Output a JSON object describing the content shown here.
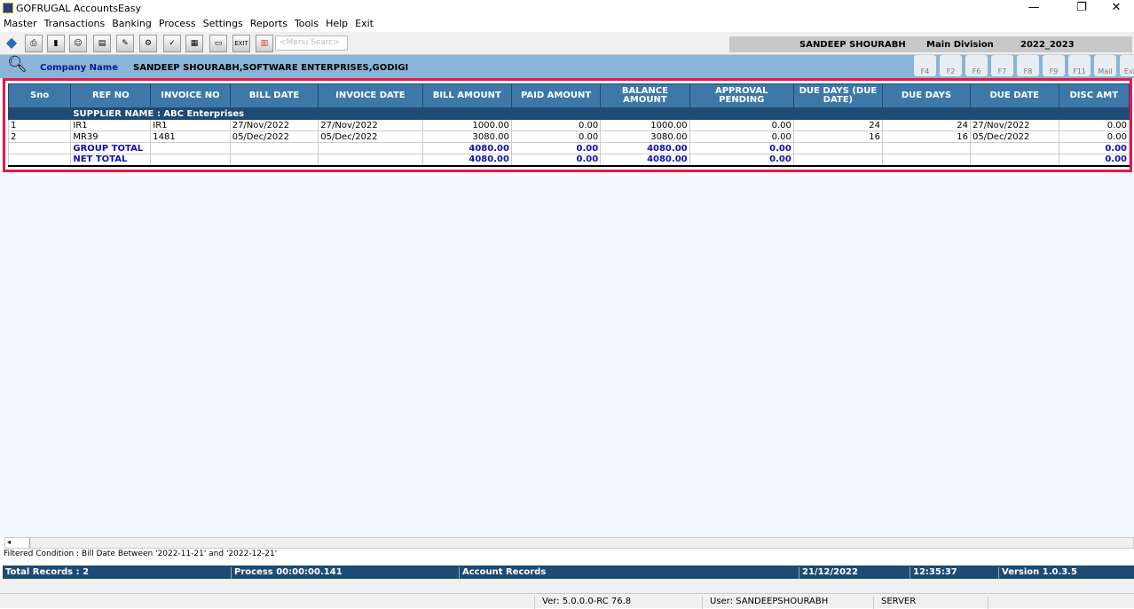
{
  "app": {
    "title": "GOFRUGAL AccountsEasy"
  },
  "menu": [
    "Master",
    "Transactions",
    "Banking",
    "Process",
    "Settings",
    "Reports",
    "Tools",
    "Help",
    "Exit"
  ],
  "toolbar": {
    "menu_search_placeholder": "<Menu Searc>",
    "exit_label": "EXIT"
  },
  "user_panel": {
    "user": "SANDEEP SHOURABH",
    "division": "Main Division",
    "year": "2022_2023"
  },
  "header": {
    "company_label": "Company Name",
    "company_value": "SANDEEP SHOURABH,SOFTWARE ENTERPRISES,GODIGI",
    "fkeys": [
      "F4",
      "F2",
      "F6",
      "F7",
      "F8",
      "F9",
      "F11",
      "Mail",
      "Exit"
    ]
  },
  "table": {
    "columns": [
      "Sno",
      "REF NO",
      "INVOICE NO",
      "BILL DATE",
      "INVOICE DATE",
      "BILL AMOUNT",
      "PAID AMOUNT",
      "BALANCE AMOUNT",
      "APPROVAL PENDING",
      "DUE DAYS (DUE DATE)",
      "DUE DAYS",
      "DUE DATE",
      "DISC AMT"
    ],
    "group_label": "SUPPLIER NAME : ABC Enterprises",
    "rows": [
      [
        "1",
        "IR1",
        "IR1",
        "27/Nov/2022",
        "27/Nov/2022",
        "1000.00",
        "0.00",
        "1000.00",
        "0.00",
        "24",
        "24",
        "27/Nov/2022",
        "0.00"
      ],
      [
        "2",
        "MR39",
        "1481",
        "05/Dec/2022",
        "05/Dec/2022",
        "3080.00",
        "0.00",
        "3080.00",
        "0.00",
        "16",
        "16",
        "05/Dec/2022",
        "0.00"
      ]
    ],
    "group_total": {
      "label": "GROUP TOTAL",
      "bill": "4080.00",
      "paid": "0.00",
      "balance": "4080.00",
      "approval": "0.00",
      "disc": "0.00"
    },
    "net_total": {
      "label": "NET TOTAL",
      "bill": "4080.00",
      "paid": "0.00",
      "balance": "4080.00",
      "approval": "0.00",
      "disc": "0.00"
    }
  },
  "filter": "Filtered Condition : Bill Date Between '2022-11-21' and '2022-12-21'",
  "status": {
    "records": "Total Records : 2",
    "process": "Process 00:00:00.141",
    "type": "Account Records",
    "date": "21/12/2022",
    "time": "12:35:37",
    "version": "Version 1.0.3.5"
  },
  "bottom": {
    "ver": "Ver: 5.0.0.0-RC 76.8",
    "user": "User: SANDEEPSHOURABH",
    "server": "SERVER"
  }
}
